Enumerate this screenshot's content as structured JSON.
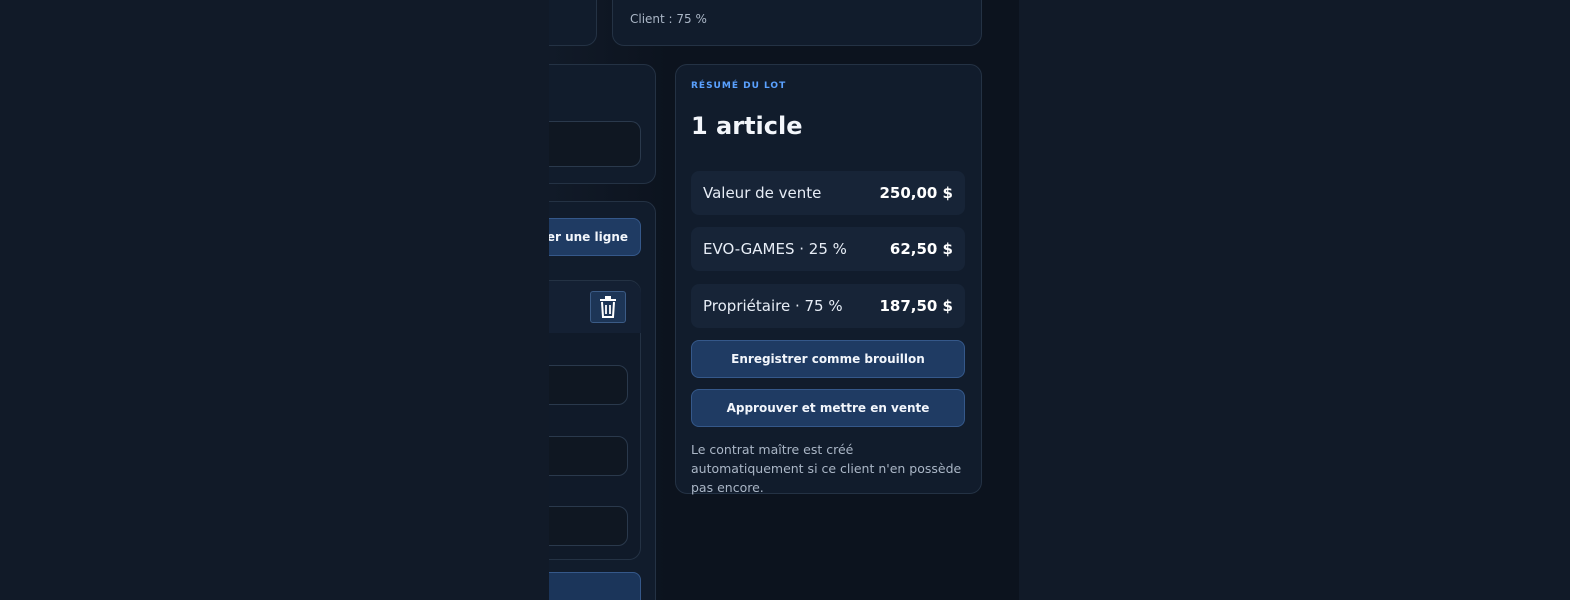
{
  "top_card": {
    "client_share": "Client : 75 %"
  },
  "lines_panel": {
    "add_line_label": "ter une ligne"
  },
  "summary": {
    "kicker": "RÉSUMÉ DU LOT",
    "headline": "1 article",
    "rows": [
      {
        "label": "Valeur de vente",
        "value": "250,00 $"
      },
      {
        "label": "EVO-GAMES · 25 %",
        "value": "62,50 $"
      },
      {
        "label": "Propriétaire · 75 %",
        "value": "187,50 $"
      }
    ],
    "save_draft_label": "Enregistrer comme brouillon",
    "approve_label": "Approuver et mettre en vente",
    "note": "Le contrat maître est créé automatiquement si ce client n'en possède pas encore."
  },
  "colors": {
    "background": "#111a28",
    "card": "#111c2c",
    "accent": "#5aa1ff",
    "button": "#1f3b63"
  },
  "icons": [
    "trash-icon"
  ]
}
